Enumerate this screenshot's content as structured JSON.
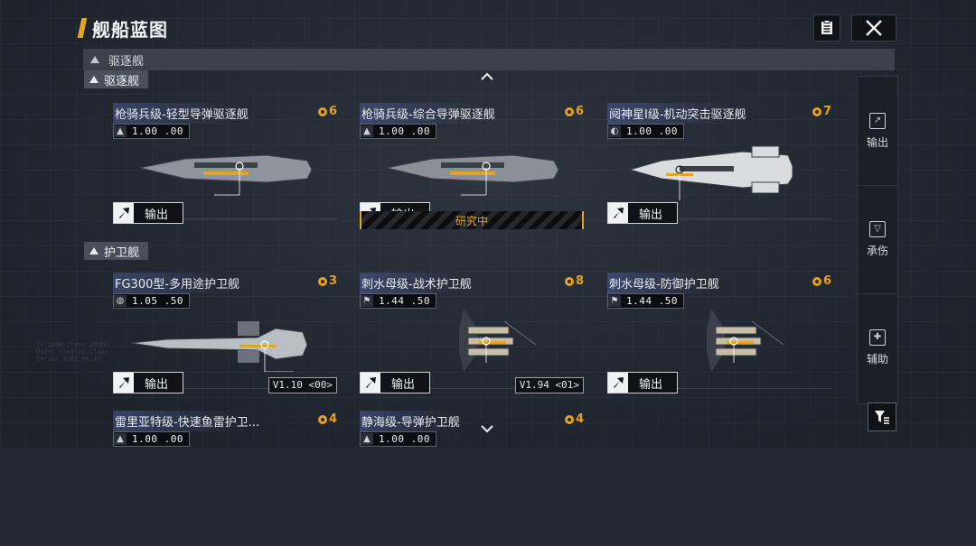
{
  "header": {
    "title": "舰船蓝图"
  },
  "toolbar": {
    "doc_icon": "document-icon",
    "close_icon": "close-icon"
  },
  "category": {
    "label": "驱逐舰"
  },
  "sections": [
    {
      "label": "驱逐舰"
    },
    {
      "label": "护卫舰"
    }
  ],
  "cards": [
    {
      "name": "枪骑兵级-轻型导弹驱逐舰",
      "cost": "6",
      "stat_icon": "missile-icon",
      "stat": "1.00 .00",
      "export": "输出",
      "hull": "#8e949b",
      "shape": "long"
    },
    {
      "name": "枪骑兵级-综合导弹驱逐舰",
      "cost": "6",
      "stat_icon": "missile-icon",
      "stat": "1.00 .00",
      "export": "输出",
      "research": "研究中",
      "hull": "#8a9096",
      "shape": "long"
    },
    {
      "name": "阋神星I级-机动突击驱逐舰",
      "cost": "7",
      "stat_icon": "speed-icon",
      "stat": "1.00 .00",
      "export": "输出",
      "hull": "#d9dcdf",
      "shape": "wedge"
    },
    {
      "name": "FG300型-多用途护卫舰",
      "cost": "3",
      "stat_icon": "globe-icon",
      "stat": "1.05 .50",
      "export": "输出",
      "version": "V1.10 <00>",
      "hull": "#b9bec3",
      "shape": "short"
    },
    {
      "name": "刺水母级-战术护卫舰",
      "cost": "8",
      "stat_icon": "flag-icon",
      "stat": "1.44 .50",
      "export": "输出",
      "version": "V1.94 <01>",
      "hull": "#c9bfa9",
      "shape": "fork"
    },
    {
      "name": "刺水母级-防御护卫舰",
      "cost": "6",
      "stat_icon": "flag-icon",
      "stat": "1.44 .50",
      "export": "输出",
      "hull": "#c9bfa9",
      "shape": "fork"
    },
    {
      "name": "雷里亚特级-快速鱼雷护卫...",
      "cost": "4",
      "stat_icon": "missile-icon",
      "stat": "1.00 .00"
    },
    {
      "name": "静海级-导弹护卫舰",
      "cost": "4",
      "stat_icon": "missile-icon",
      "stat": "1.00 .00"
    }
  ],
  "side_panel": [
    {
      "label": "输出",
      "icon": "export-icon"
    },
    {
      "label": "承伤",
      "icon": "shield-icon"
    },
    {
      "label": "辅助",
      "icon": "support-icon"
    }
  ],
  "filter": {
    "icon": "filter-icon"
  }
}
